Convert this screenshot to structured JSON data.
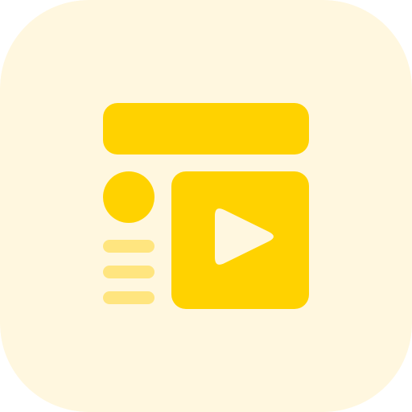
{
  "icon": {
    "name": "video-content-layout-icon",
    "colors": {
      "tile_background": "#FFF7DF",
      "primary": "#FFD200",
      "muted_lines": "#FFE57F",
      "play_triangle": "#FFF7DF"
    }
  }
}
